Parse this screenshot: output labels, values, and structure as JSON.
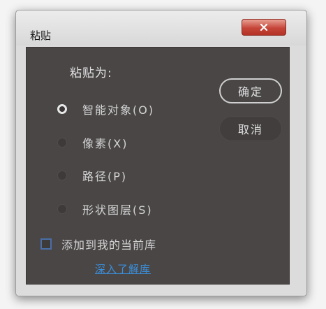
{
  "window": {
    "title": "粘贴"
  },
  "dialog": {
    "paste_as_label": "粘贴为:",
    "options": [
      {
        "label": "智能对象(O)",
        "checked": true
      },
      {
        "label": "像素(X)",
        "checked": false
      },
      {
        "label": "路径(P)",
        "checked": false
      },
      {
        "label": "形状图层(S)",
        "checked": false
      }
    ],
    "ok_label": "确定",
    "cancel_label": "取消",
    "add_to_library_label": "添加到我的当前库",
    "learn_more_label": "深入了解库"
  },
  "icons": {
    "close": "close-icon"
  },
  "colors": {
    "panel_background": "#4a4646",
    "close_button": "#c6463a",
    "link": "#3a8ed8",
    "checkbox_border": "#4a6fa8"
  }
}
